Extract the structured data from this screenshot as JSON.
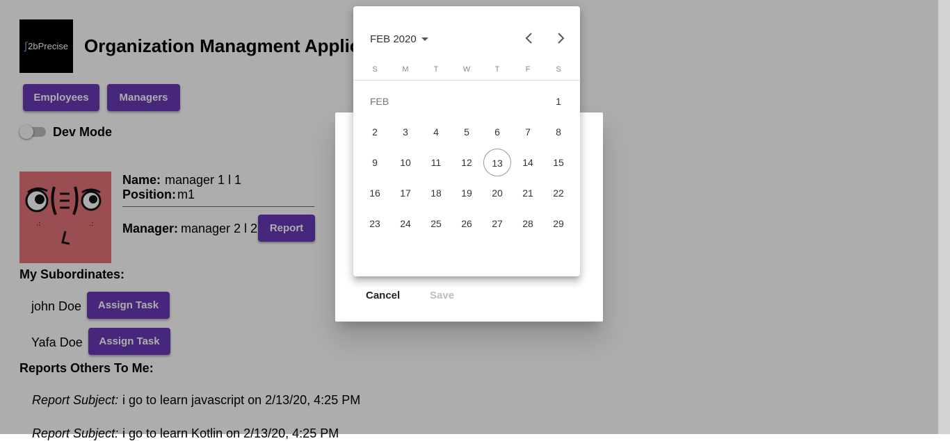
{
  "app": {
    "logo_text": "2bPrecise",
    "title": "Organization Managment Application"
  },
  "nav": {
    "employees": "Employees",
    "managers": "Managers"
  },
  "dev_mode": {
    "label": "Dev Mode",
    "enabled": false
  },
  "profile": {
    "name_label": "Name:",
    "name_value": "manager 1 l 1",
    "position_label": "Position:",
    "position_value": "m1",
    "manager_label": "Manager:",
    "manager_value": "manager 2 l 2",
    "report_button": "Report"
  },
  "subordinates": {
    "heading": "My Subordinates:",
    "items": [
      {
        "name": "john Doe",
        "action": "Assign Task"
      },
      {
        "name": "Yafa Doe",
        "action": "Assign Task"
      }
    ]
  },
  "reports": {
    "heading": "Reports Others To Me:",
    "items": [
      {
        "subject_label": "Report Subject:",
        "text": "i go to learn javascript on 2/13/20, 4:25 PM"
      },
      {
        "subject_label": "Report Subject:",
        "text": "i go to learn Kotlin on 2/13/20, 4:25 PM"
      }
    ]
  },
  "dialog": {
    "cancel": "Cancel",
    "save": "Save"
  },
  "datepicker": {
    "period": "FEB 2020",
    "month_label": "FEB",
    "weekdays": [
      "S",
      "M",
      "T",
      "W",
      "T",
      "F",
      "S"
    ],
    "days": [
      "1",
      "2",
      "3",
      "4",
      "5",
      "6",
      "7",
      "8",
      "9",
      "10",
      "11",
      "12",
      "13",
      "14",
      "15",
      "16",
      "17",
      "18",
      "19",
      "20",
      "21",
      "22",
      "23",
      "24",
      "25",
      "26",
      "27",
      "28",
      "29"
    ],
    "first_weekday_index": 6,
    "today": "13",
    "prev_icon": "chevron-left-icon",
    "next_icon": "chevron-right-icon"
  },
  "colors": {
    "primary": "#673ab7",
    "avatar_bg": "#e5737a"
  }
}
